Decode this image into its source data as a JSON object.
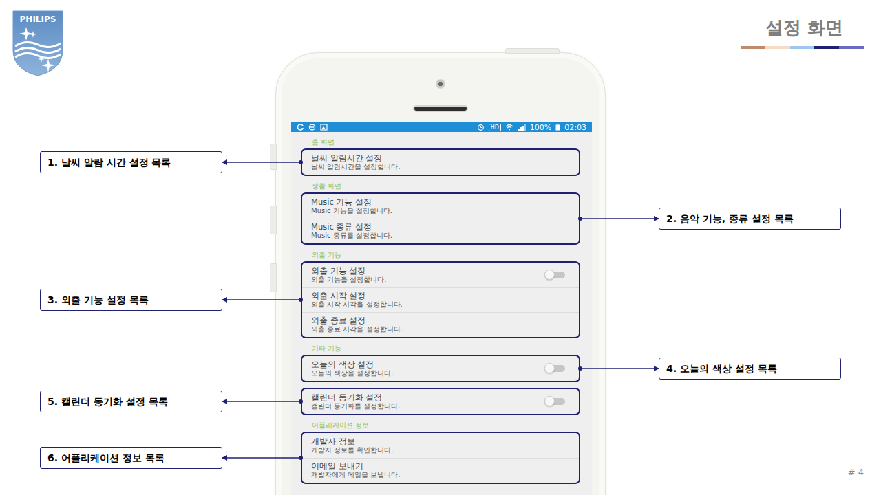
{
  "logo": {
    "text": "PHILIPS"
  },
  "title": "설정 화면",
  "page_number": "# 4",
  "phone": {
    "status_bar": {
      "badge": "HD",
      "battery": "100%",
      "time": "02:03"
    },
    "sections": [
      {
        "header": "홈 화면",
        "groups": [
          {
            "callout": "1. 날씨 알람 시간 설정 목록",
            "items": [
              {
                "title": "날씨 알람시간 설정",
                "subtitle": "날씨 알람시간을 설정합니다.",
                "kind": "text"
              }
            ]
          }
        ]
      },
      {
        "header": "생활 화면",
        "groups": [
          {
            "callout": "2. 음악 기능, 종류 설정 목록",
            "items": [
              {
                "title": "Music 기능 설정",
                "subtitle": "Music 기능을 설정합니다.",
                "kind": "text"
              },
              {
                "title": "Music 종류 설정",
                "subtitle": "Music 종류를 설정합니다.",
                "kind": "text"
              }
            ]
          }
        ]
      },
      {
        "header": "외출 기능",
        "groups": [
          {
            "callout": "3. 외출 기능 설정 목록",
            "items": [
              {
                "title": "외출 기능 설정",
                "subtitle": "외출 기능을 설정합니다.",
                "kind": "toggle",
                "on": false
              },
              {
                "title": "외출 시작 설정",
                "subtitle": "외출 시작 시각을 설정합니다.",
                "kind": "text"
              },
              {
                "title": "외출 종료 설정",
                "subtitle": "외출 종료 시각을 설정합니다.",
                "kind": "text"
              }
            ]
          }
        ]
      },
      {
        "header": "기타 기능",
        "groups": [
          {
            "callout": "4. 오늘의 색상 설정 목록",
            "items": [
              {
                "title": "오늘의 색상 설정",
                "subtitle": "오늘의 색상을 설정합니다.",
                "kind": "toggle",
                "on": false
              }
            ]
          },
          {
            "callout": "5. 캘린더 동기화 설정 목록",
            "items": [
              {
                "title": "캘린더 동기화 설정",
                "subtitle": "캘린더 동기화를 설정합니다.",
                "kind": "toggle",
                "on": false
              }
            ]
          }
        ]
      },
      {
        "header": "어플리케이션 정보",
        "groups": [
          {
            "callout": "6. 어플리케이션 정보 목록",
            "items": [
              {
                "title": "개발자 정보",
                "subtitle": "개발자 정보를 확인합니다.",
                "kind": "text"
              },
              {
                "title": "이메일 보내기",
                "subtitle": "개발자에게 메일을 보냅니다.",
                "kind": "text"
              }
            ]
          }
        ]
      }
    ]
  }
}
